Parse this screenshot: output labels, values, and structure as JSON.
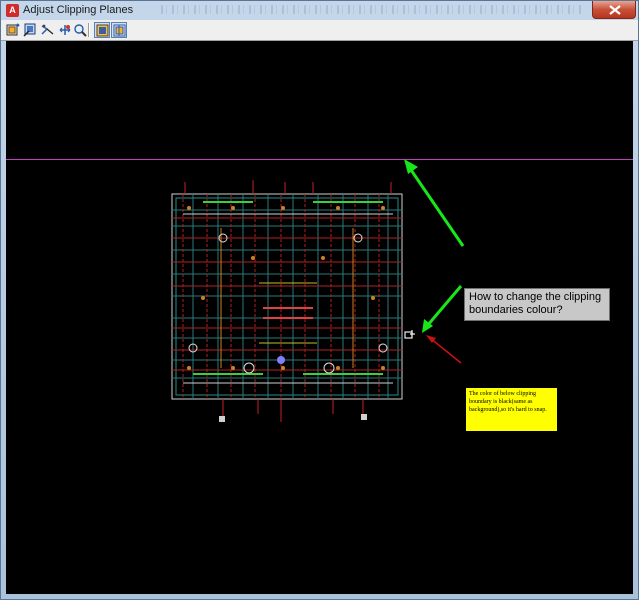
{
  "window": {
    "title": "Adjust Clipping Planes",
    "app_icon_letter": "A"
  },
  "toolbar": {
    "buttons": [
      {
        "name": "adjust-front-clipping-button",
        "icon": "front-clip-icon",
        "active": false
      },
      {
        "name": "adjust-back-clipping-button",
        "icon": "back-clip-icon",
        "active": false
      },
      {
        "name": "create-slice-button",
        "icon": "slice-icon",
        "active": false
      },
      {
        "name": "pan-button",
        "icon": "pan-icon",
        "active": false
      },
      {
        "name": "zoom-button",
        "icon": "zoom-icon",
        "active": false
      },
      {
        "name": "front-clipping-on-button",
        "icon": "front-clip-on-icon",
        "active": true
      },
      {
        "name": "back-clipping-on-button",
        "icon": "back-clip-on-icon",
        "active": true
      }
    ]
  },
  "annotations": {
    "question": "How to change the clipping boundaries colour?",
    "note": "The color of  below clipping boundary is black(same as background),so it's hard to snap."
  },
  "colors": {
    "clip_line": "#c040c0",
    "arrow_green": "#19e619",
    "arrow_red": "#cc1111",
    "note_bg": "#ffff00",
    "callout_bg": "#c8c8c8"
  }
}
